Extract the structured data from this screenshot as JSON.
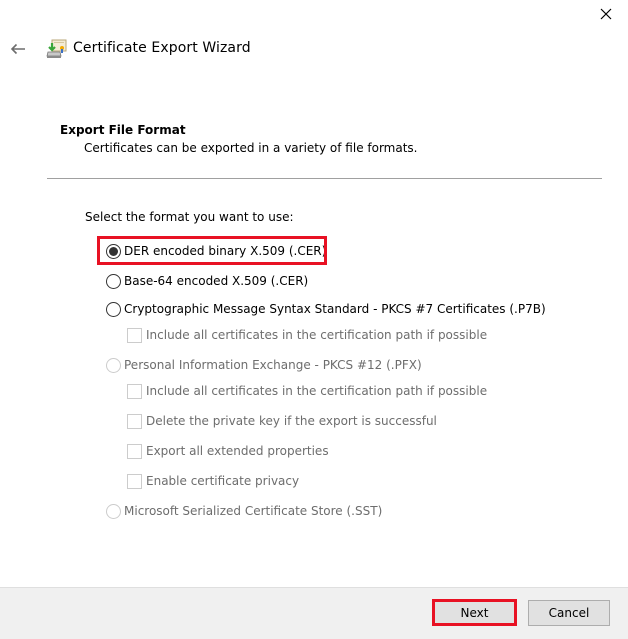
{
  "window": {
    "close_icon": "close-icon"
  },
  "header": {
    "back_icon": "back-arrow-icon",
    "wizard_icon": "certificate-export-icon",
    "title": "Certificate Export Wizard"
  },
  "section": {
    "title": "Export File Format",
    "description": "Certificates can be exported in a variety of file formats."
  },
  "format": {
    "prompt": "Select the format you want to use:",
    "selected": "der",
    "options": [
      {
        "id": "der",
        "label": "DER encoded binary X.509 (.CER)",
        "type": "radio",
        "checked": true,
        "enabled": true,
        "highlighted": true
      },
      {
        "id": "base64",
        "label": "Base-64 encoded X.509 (.CER)",
        "type": "radio",
        "checked": false,
        "enabled": true
      },
      {
        "id": "p7b",
        "label": "Cryptographic Message Syntax Standard - PKCS #7 Certificates (.P7B)",
        "type": "radio",
        "checked": false,
        "enabled": true
      },
      {
        "id": "p7b-include",
        "label": "Include all certificates in the certification path if possible",
        "type": "checkbox",
        "checked": false,
        "enabled": false
      },
      {
        "id": "pfx",
        "label": "Personal Information Exchange - PKCS #12 (.PFX)",
        "type": "radio",
        "checked": false,
        "enabled": false
      },
      {
        "id": "pfx-include",
        "label": "Include all certificates in the certification path if possible",
        "type": "checkbox",
        "checked": false,
        "enabled": false
      },
      {
        "id": "pfx-delete-key",
        "label": "Delete the private key if the export is successful",
        "type": "checkbox",
        "checked": false,
        "enabled": false
      },
      {
        "id": "pfx-extended",
        "label": "Export all extended properties",
        "type": "checkbox",
        "checked": false,
        "enabled": false
      },
      {
        "id": "pfx-privacy",
        "label": "Enable certificate privacy",
        "type": "checkbox",
        "checked": false,
        "enabled": false
      },
      {
        "id": "sst",
        "label": "Microsoft Serialized Certificate Store (.SST)",
        "type": "radio",
        "checked": false,
        "enabled": false
      }
    ]
  },
  "footer": {
    "next_label": "Next",
    "cancel_label": "Cancel"
  },
  "colors": {
    "highlight": "#e81123",
    "footer_bg": "#f0f0f0",
    "disabled_text": "#6d6d6d"
  }
}
